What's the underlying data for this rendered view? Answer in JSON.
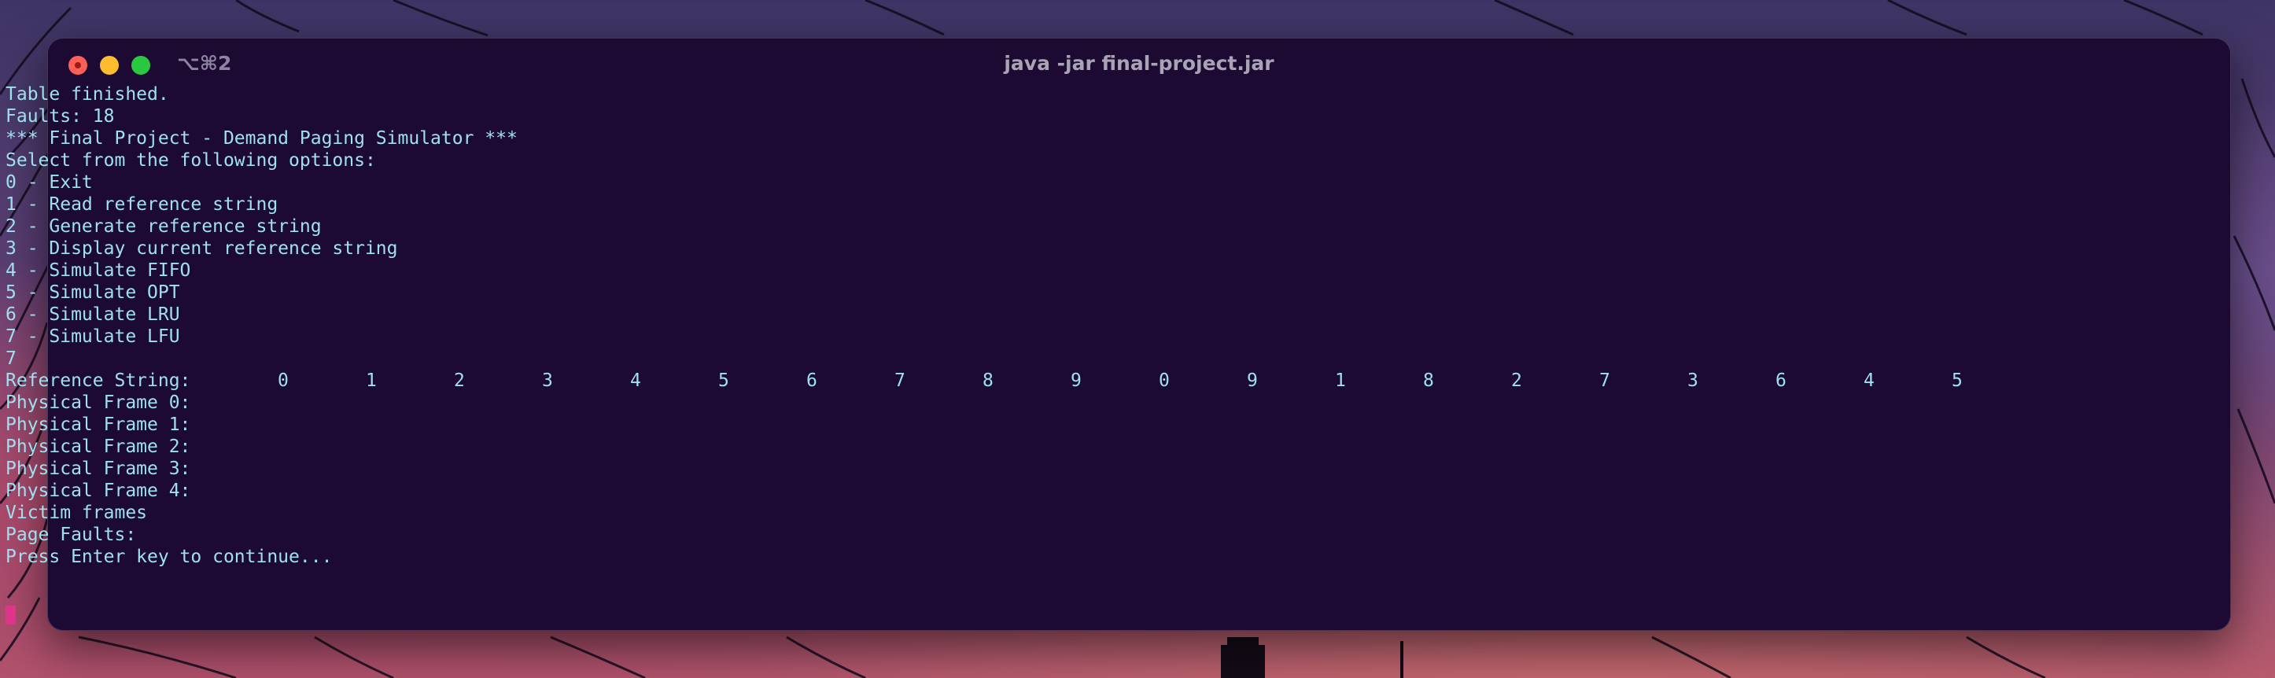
{
  "window": {
    "shortcut": "⌥⌘2",
    "title": "java -jar final-project.jar"
  },
  "terminal": {
    "lines_before": [
      "Table finished.",
      "Faults: 18",
      "*** Final Project - Demand Paging Simulator ***",
      "Select from the following options:",
      "0 - Exit",
      "1 - Read reference string",
      "2 - Generate reference string",
      "3 - Display current reference string",
      "4 - Simulate FIFO",
      "5 - Simulate OPT",
      "6 - Simulate LRU",
      "7 - Simulate LFU",
      "7"
    ],
    "reference_label": "Reference String:",
    "reference_values": [
      "0",
      "1",
      "2",
      "3",
      "4",
      "5",
      "6",
      "7",
      "8",
      "9",
      "0",
      "9",
      "1",
      "8",
      "2",
      "7",
      "3",
      "6",
      "4",
      "5"
    ],
    "lines_after": [
      "Physical Frame 0:",
      "Physical Frame 1:",
      "Physical Frame 2:",
      "Physical Frame 3:",
      "Physical Frame 4:",
      "Victim frames",
      "Page Faults:",
      "Press Enter key to continue..."
    ]
  },
  "colors": {
    "terminal_bg": "#1c0a33",
    "terminal_text": "#9fe0ef",
    "cursor": "#e0338a"
  }
}
